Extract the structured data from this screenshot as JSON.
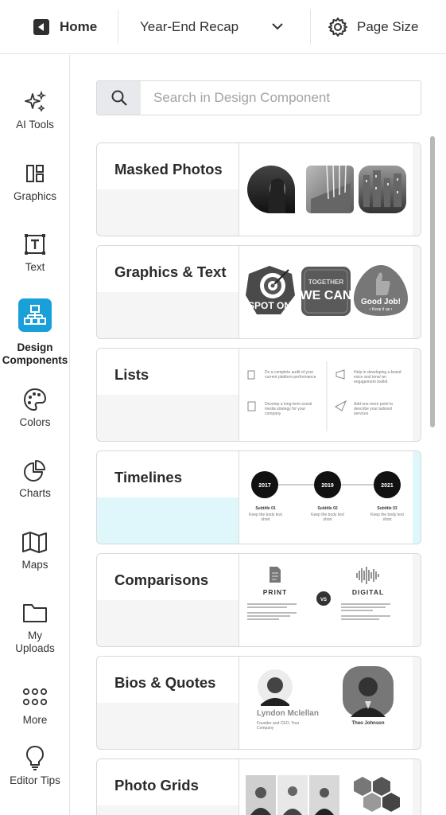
{
  "topbar": {
    "home_label": "Home",
    "project_name": "Year-End Recap",
    "page_size_label": "Page Size"
  },
  "sidebar": {
    "items": [
      {
        "label": "AI Tools",
        "icon": "sparkle-icon"
      },
      {
        "label": "Graphics",
        "icon": "layout-icon"
      },
      {
        "label": "Text",
        "icon": "text-box-icon"
      },
      {
        "label": "Design Components",
        "icon": "hierarchy-icon",
        "active": true
      },
      {
        "label": "Colors",
        "icon": "palette-icon"
      },
      {
        "label": "Charts",
        "icon": "pie-chart-icon"
      },
      {
        "label": "Maps",
        "icon": "map-icon"
      },
      {
        "label": "My Uploads",
        "icon": "folder-icon"
      },
      {
        "label": "More",
        "icon": "grid-dots-icon"
      },
      {
        "label": "Editor Tips",
        "icon": "lightbulb-icon"
      }
    ]
  },
  "search": {
    "placeholder": "Search in Design Component"
  },
  "categories": [
    {
      "title": "Masked Photos"
    },
    {
      "title": "Graphics & Text",
      "badges": [
        "SPOT ON",
        "TOGETHER",
        "WE CAN",
        "Good Job!",
        "• Keep it up •"
      ]
    },
    {
      "title": "Lists",
      "items": [
        "Do a complete audit of your current platform performance",
        "Help in developing a brand voice and tone/ an engagement toolkit",
        "Develop a long-term social media strategy for your company",
        "Add one more point to describe your tailored services"
      ]
    },
    {
      "title": "Timelines",
      "years": [
        "2017",
        "2019",
        "2021"
      ],
      "labels": [
        "Subtitle 01",
        "Subtitle 02",
        "Subtitle 03"
      ],
      "sublabel": "Keep the body text short"
    },
    {
      "title": "Comparisons",
      "left": "PRINT",
      "vs": "VS",
      "right": "DIGITAL"
    },
    {
      "title": "Bios & Quotes",
      "bio1_name": "Lyndon Mclellan",
      "bio1_role": "Founder and CEO, Your Company",
      "bio2_name": "Theo Johnson"
    },
    {
      "title": "Photo Grids"
    }
  ],
  "colors": {
    "accent": "#1aa0d8",
    "timeline_highlight": "#dff6fb"
  }
}
